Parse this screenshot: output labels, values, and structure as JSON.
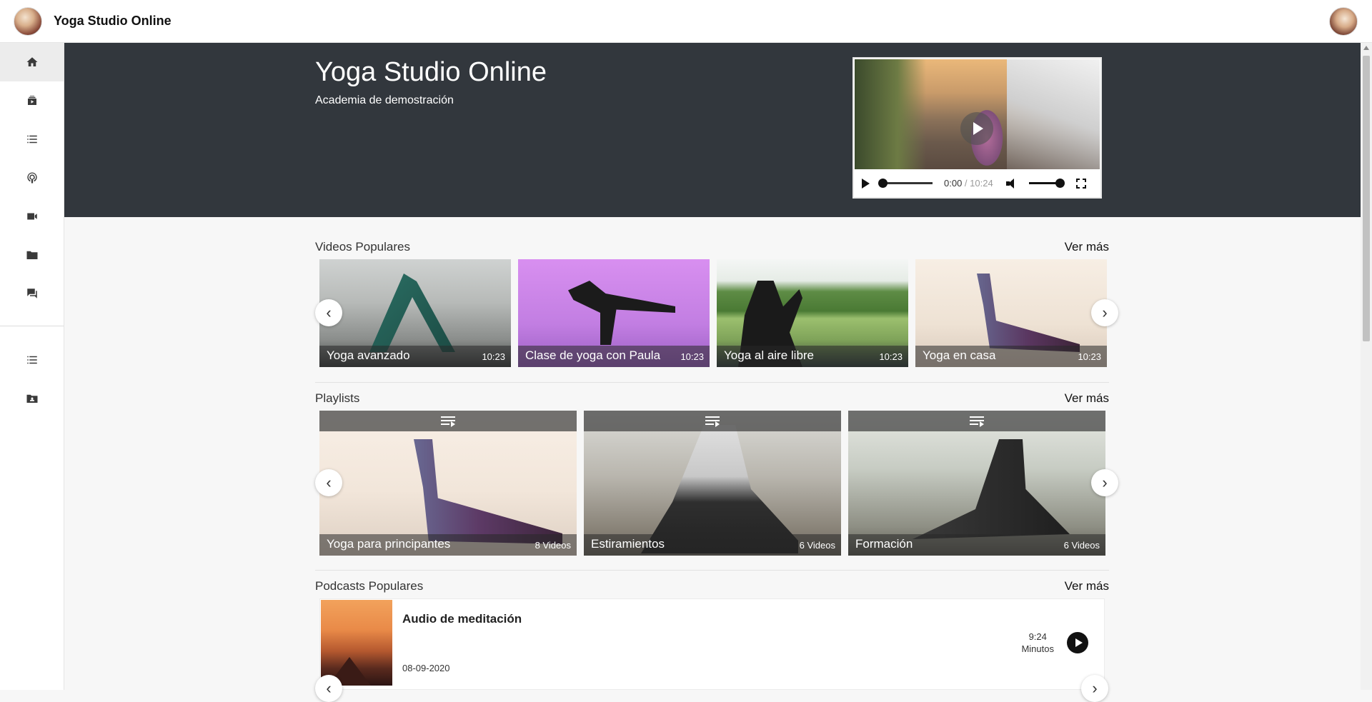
{
  "app": {
    "title": "Yoga Studio Online"
  },
  "hero": {
    "title": "Yoga Studio Online",
    "subtitle": "Academia de demostración"
  },
  "player": {
    "current_time": "0:00",
    "separator": " / ",
    "duration": "10:24",
    "progress": 0,
    "volume": 1
  },
  "sidebar": {
    "items": [
      {
        "icon": "home-icon",
        "active": true
      },
      {
        "icon": "video-library-icon"
      },
      {
        "icon": "list-icon"
      },
      {
        "icon": "podcast-icon"
      },
      {
        "icon": "videocam-icon"
      },
      {
        "icon": "folder-icon"
      },
      {
        "icon": "forum-icon"
      },
      {
        "icon": "list-icon"
      },
      {
        "icon": "contact-folder-icon"
      }
    ]
  },
  "videos": {
    "title": "Videos Populares",
    "more": "Ver más",
    "items": [
      {
        "title": "Yoga avanzado",
        "duration": "10:23"
      },
      {
        "title": "Clase de yoga con Paula",
        "duration": "10:23"
      },
      {
        "title": "Yoga al aire libre",
        "duration": "10:23"
      },
      {
        "title": "Yoga en casa",
        "duration": "10:23"
      }
    ]
  },
  "playlists": {
    "title": "Playlists",
    "more": "Ver más",
    "items": [
      {
        "title": "Yoga para principantes",
        "count": "8 Videos"
      },
      {
        "title": "Estiramientos",
        "count": "6 Videos"
      },
      {
        "title": "Formación",
        "count": "6 Videos"
      }
    ]
  },
  "podcasts": {
    "title": "Podcasts Populares",
    "more": "Ver más",
    "items": [
      {
        "title": "Audio de meditación",
        "date": "08-09-2020",
        "duration": "9:24",
        "unit": "Minutos"
      }
    ]
  },
  "arrows": {
    "prev": "‹",
    "next": "›"
  },
  "colors": {
    "hero_bg": "#32373d",
    "sidebar_active": "#ececec",
    "page_bg": "#f7f7f7"
  }
}
